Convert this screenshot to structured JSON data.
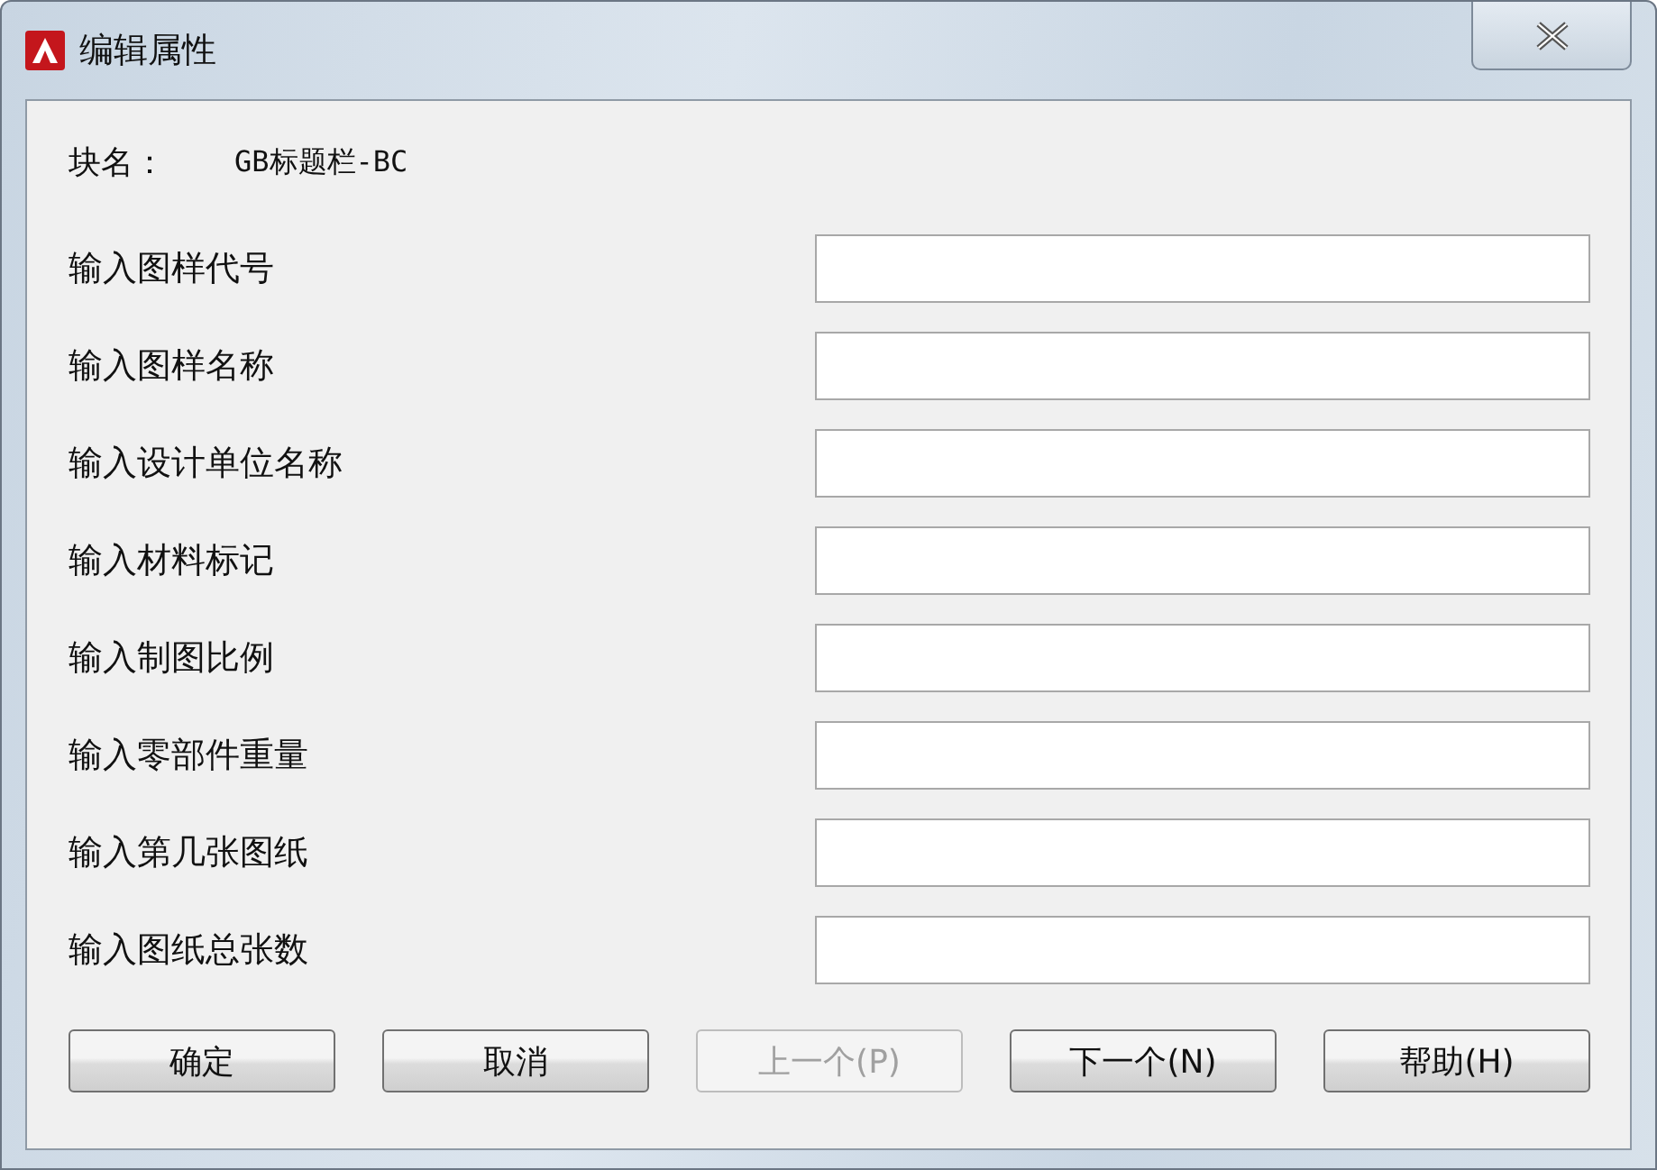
{
  "window": {
    "title": "编辑属性"
  },
  "block_name": {
    "label": "块名：",
    "value": "GB标题栏-BC"
  },
  "fields": [
    {
      "label": "输入图样代号"
    },
    {
      "label": "输入图样名称"
    },
    {
      "label": "输入设计单位名称"
    },
    {
      "label": "输入材料标记"
    },
    {
      "label": "输入制图比例"
    },
    {
      "label": "输入零部件重量"
    },
    {
      "label": "输入第几张图纸"
    },
    {
      "label": "输入图纸总张数"
    }
  ],
  "buttons": [
    {
      "label": "确定",
      "disabled": false
    },
    {
      "label": "取消",
      "disabled": false
    },
    {
      "label": "上一个(P)",
      "disabled": true
    },
    {
      "label": "下一个(N)",
      "disabled": false
    },
    {
      "label": "帮助(H)",
      "disabled": false
    }
  ]
}
